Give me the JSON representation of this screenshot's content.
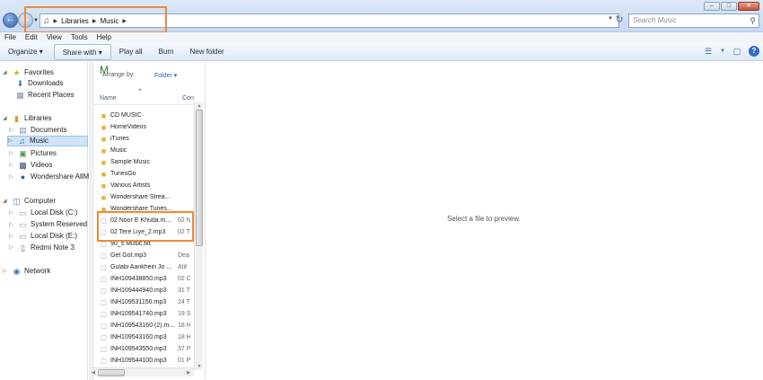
{
  "address": {
    "crumbs": [
      "Libraries",
      "Music"
    ],
    "search_placeholder": "Search Music"
  },
  "menu": [
    "File",
    "Edit",
    "View",
    "Tools",
    "Help"
  ],
  "toolbar": {
    "organize": "Organize",
    "share": "Share with",
    "play": "Play all",
    "burn": "Burn",
    "newfolder": "New folder"
  },
  "nav": {
    "favorites": "Favorites",
    "downloads": "Downloads",
    "recent": "Recent Places",
    "libraries": "Libraries",
    "documents": "Documents",
    "music": "Music",
    "pictures": "Pictures",
    "videos": "Videos",
    "wondershare": "Wondershare AllMy",
    "computer": "Computer",
    "local_c": "Local Disk (C:)",
    "system_reserved": "System Reserved (D:",
    "local_e": "Local Disk (E:)",
    "redmi": "Redmi Note 3",
    "network": "Network"
  },
  "list": {
    "lib_title": "M",
    "arrange_label": "Arrange by:",
    "arrange_value": "Folder",
    "col_name": "Name",
    "col_con": "Con",
    "items": [
      {
        "name": "CD MUSIC",
        "extra": ""
      },
      {
        "name": "HomeVideos",
        "extra": ""
      },
      {
        "name": "iTunes",
        "extra": ""
      },
      {
        "name": "Music",
        "extra": ""
      },
      {
        "name": "Sample Music",
        "extra": ""
      },
      {
        "name": "TunesGo",
        "extra": ""
      },
      {
        "name": "Various Artists",
        "extra": ""
      },
      {
        "name": "Wondershare Strea...",
        "extra": ""
      },
      {
        "name": "Wondershare Tunes...",
        "extra": ""
      },
      {
        "name": "02 Noor E Khuda.m...",
        "extra": "02 N"
      },
      {
        "name": "02 Tere Liye_2.mp3",
        "extra": "02 T"
      },
      {
        "name": "90_s Music.txt",
        "extra": ""
      },
      {
        "name": "Get Got.mp3",
        "extra": "Dea"
      },
      {
        "name": "Gulabi Aankhein Jo ...",
        "extra": "Atif"
      },
      {
        "name": "INH109438850.mp3",
        "extra": "02 C"
      },
      {
        "name": "INH109444940.mp3",
        "extra": "31 T"
      },
      {
        "name": "INH109531150.mp3",
        "extra": "24 T"
      },
      {
        "name": "INH109541740.mp3",
        "extra": "19 S"
      },
      {
        "name": "INH109543160 (2).m...",
        "extra": "18 H"
      },
      {
        "name": "INH109543160.mp3",
        "extra": "18 H"
      },
      {
        "name": "INH109543550.mp3",
        "extra": "37 P"
      },
      {
        "name": "INH109544100.mp3",
        "extra": "01 P"
      }
    ]
  },
  "preview": {
    "message": "Select a file to preview."
  }
}
